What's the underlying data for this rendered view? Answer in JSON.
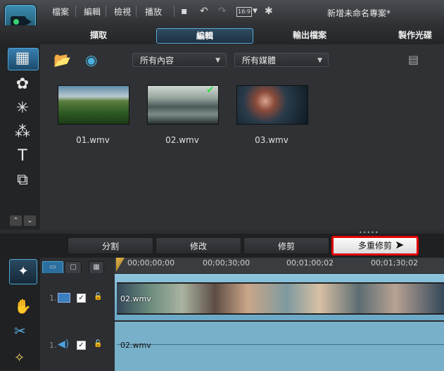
{
  "app": {
    "title": "新增未命名專案*"
  },
  "menu": {
    "items": [
      "檔案",
      "編輯",
      "檢視",
      "播放"
    ]
  },
  "toolbar": {
    "aspect_ratio": "16:9"
  },
  "tabs": [
    "擷取",
    "編輯",
    "輸出檔案",
    "製作光碟"
  ],
  "media": {
    "filter_content": "所有內容",
    "filter_media": "所有媒體",
    "items": [
      {
        "label": "01.wmv",
        "checked": false
      },
      {
        "label": "02.wmv",
        "checked": true
      },
      {
        "label": "03.wmv",
        "checked": false
      }
    ]
  },
  "commands": {
    "split": "分割",
    "modify": "修改",
    "trim": "修剪",
    "multi_trim": "多重修剪"
  },
  "timeline": {
    "ticks": [
      "00;00;00;00",
      "00;00;30;00",
      "00;01;00;02",
      "00;01;30;02"
    ],
    "video_track": {
      "number": "1.",
      "clip": "02.wmv"
    },
    "audio_track": {
      "number": "1.",
      "clip": "02.wmv"
    }
  },
  "colors": {
    "accent": "#4fa8d8",
    "highlight": "#e00000",
    "track": "#79b0c9"
  }
}
